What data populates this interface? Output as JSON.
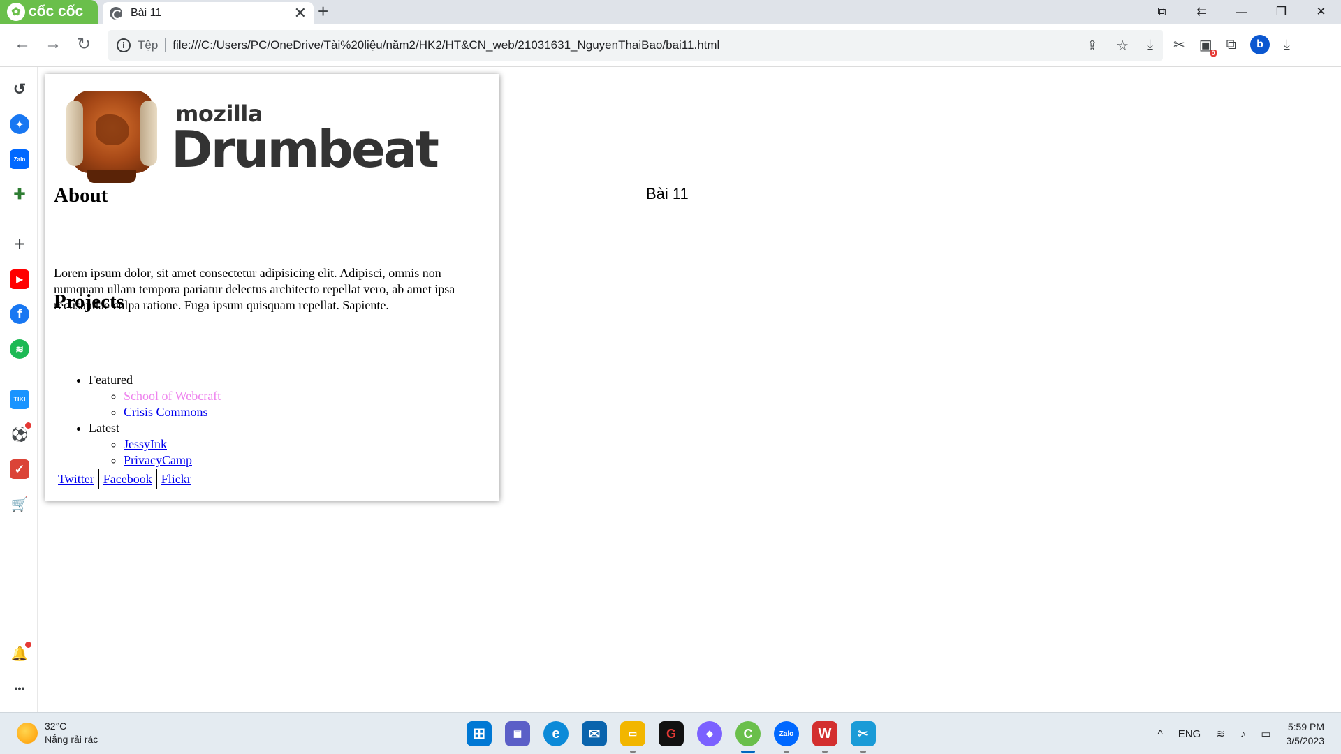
{
  "browser": {
    "brand": "cốc cốc",
    "tab": {
      "title": "Bài 11",
      "close": "✕"
    },
    "new_tab": "+",
    "window_controls": {
      "screen": "⧉",
      "back_list": "⇇",
      "minimize": "—",
      "maximize": "❐",
      "close": "✕"
    },
    "nav": {
      "back": "←",
      "forward": "→",
      "reload": "↻"
    },
    "address": {
      "info_icon": "i",
      "scheme_label": "Tệp",
      "url": "file:///C:/Users/PC/OneDrive/Tài%20liệu/năm2/HK2/HT&CN_web/21031631_NguyenThaiBao/bai11.html"
    },
    "omni_icons": {
      "share": "⇪",
      "star": "☆",
      "download_page": "⤓"
    },
    "extensions": {
      "tools": "✂",
      "badge_count": "0",
      "puzzle": "⧉",
      "profile_letter": "b",
      "downloads": "⤓"
    }
  },
  "sidebar": {
    "items": [
      {
        "name": "history",
        "glyph": "↺",
        "color": "#3c4043"
      },
      {
        "name": "messenger",
        "glyph": "✦",
        "color": "#1877f2"
      },
      {
        "name": "zalo",
        "glyph": "Zalo",
        "color": "#0068ff"
      },
      {
        "name": "game",
        "glyph": "✚",
        "color": "#2e7d32"
      },
      {
        "name": "add",
        "glyph": "+",
        "color": "#3c4043"
      },
      {
        "name": "youtube",
        "glyph": "▶",
        "color": "#ff0000"
      },
      {
        "name": "facebook",
        "glyph": "f",
        "color": "#1877f2"
      },
      {
        "name": "spotify",
        "glyph": "≋",
        "color": "#1db954"
      },
      {
        "name": "tiki",
        "glyph": "TIKI",
        "color": "#1a94ff"
      },
      {
        "name": "soccer",
        "glyph": "⚽",
        "color": "#2e7d32"
      },
      {
        "name": "todo",
        "glyph": "✓",
        "color": "#db4437"
      },
      {
        "name": "shop",
        "glyph": "🛒",
        "color": "#ff8a00"
      }
    ],
    "bell": "🔔",
    "more": "•••"
  },
  "page": {
    "logo": {
      "line1": "mozilla",
      "line2": "Drumbeat"
    },
    "about_heading": "About",
    "about_text": "Lorem ipsum dolor, sit amet consectetur adipisicing elit. Adipisci, omnis non numquam ullam tempora pariatur delectus architecto repellat vero, ab amet ipsa recusandae culpa ratione. Fuga ipsum quisquam repellat. Sapiente.",
    "projects_heading": "Projects",
    "projects": [
      {
        "label": "Featured",
        "links": [
          "School of Webcraft",
          "Crisis Commons"
        ]
      },
      {
        "label": "Latest",
        "links": [
          "JessyInk",
          "PrivacyCamp"
        ]
      }
    ],
    "social": [
      "Twitter",
      "Facebook",
      "Flickr"
    ],
    "title": "Bài 11"
  },
  "taskbar": {
    "weather": {
      "temp": "32°C",
      "desc": "Nắng rải rác"
    },
    "apps": [
      {
        "name": "start",
        "glyph": "⊞",
        "color": "#0078d4"
      },
      {
        "name": "meet",
        "glyph": "▣",
        "color": "#5b5fc7"
      },
      {
        "name": "edge",
        "glyph": "e",
        "color": "#0c8ad8"
      },
      {
        "name": "mail",
        "glyph": "✉",
        "color": "#0a64ad"
      },
      {
        "name": "explorer",
        "glyph": "▭",
        "color": "#f2b600"
      },
      {
        "name": "garena",
        "glyph": "G",
        "color": "#111111"
      },
      {
        "name": "copilot",
        "glyph": "◆",
        "color": "#7b61ff"
      },
      {
        "name": "coccoc",
        "glyph": "C",
        "color": "#6abf4b"
      },
      {
        "name": "zalo",
        "glyph": "Zalo",
        "color": "#0068ff"
      },
      {
        "name": "wps",
        "glyph": "W",
        "color": "#d32f2f"
      },
      {
        "name": "snipping",
        "glyph": "✂",
        "color": "#1a9bd7"
      }
    ],
    "tray": {
      "chevron": "^",
      "lang": "ENG",
      "wifi": "≋",
      "volume": "♪",
      "battery": "▭"
    },
    "clock": {
      "time": "5:59 PM",
      "date": "3/5/2023"
    }
  }
}
